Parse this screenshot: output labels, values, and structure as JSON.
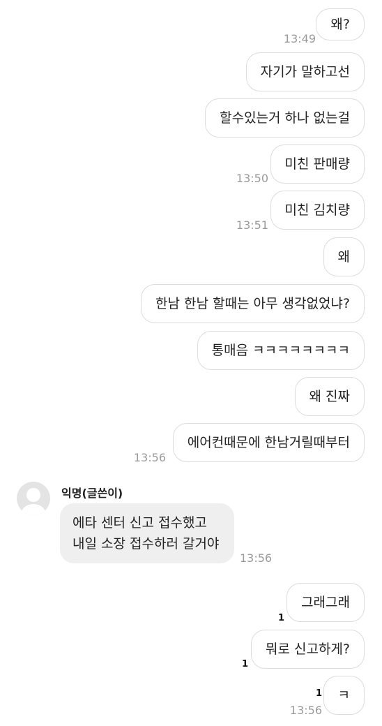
{
  "messages": [
    {
      "text": "왜?",
      "time": "13:49"
    },
    {
      "text": "자기가 말하고선"
    },
    {
      "text": "할수있는거 하나 없는걸"
    },
    {
      "text": "미친 판매량",
      "time": "13:50"
    },
    {
      "text": "미친 김치량",
      "time": "13:51"
    },
    {
      "text": "왜"
    },
    {
      "text": "한남 한남 할때는 아무 생각없었냐?"
    },
    {
      "text": "통매음 ㅋㅋㅋㅋㅋㅋㅋㅋ"
    },
    {
      "text": "왜 진짜"
    },
    {
      "text": "에어컨때문에 한남거릴때부터",
      "time": "13:56"
    }
  ],
  "incoming": {
    "sender": "익명(글쓴이)",
    "line1": "에타 센터 신고 접수했고",
    "line2": "내일 소장 접수하러 갈거야",
    "time": "13:56"
  },
  "replies": [
    {
      "text": "그래그래",
      "unread": "1"
    },
    {
      "text": "뭐로 신고하게?",
      "unread": "1"
    },
    {
      "text": "ㅋ",
      "unread": "1",
      "time": "13:56"
    }
  ]
}
